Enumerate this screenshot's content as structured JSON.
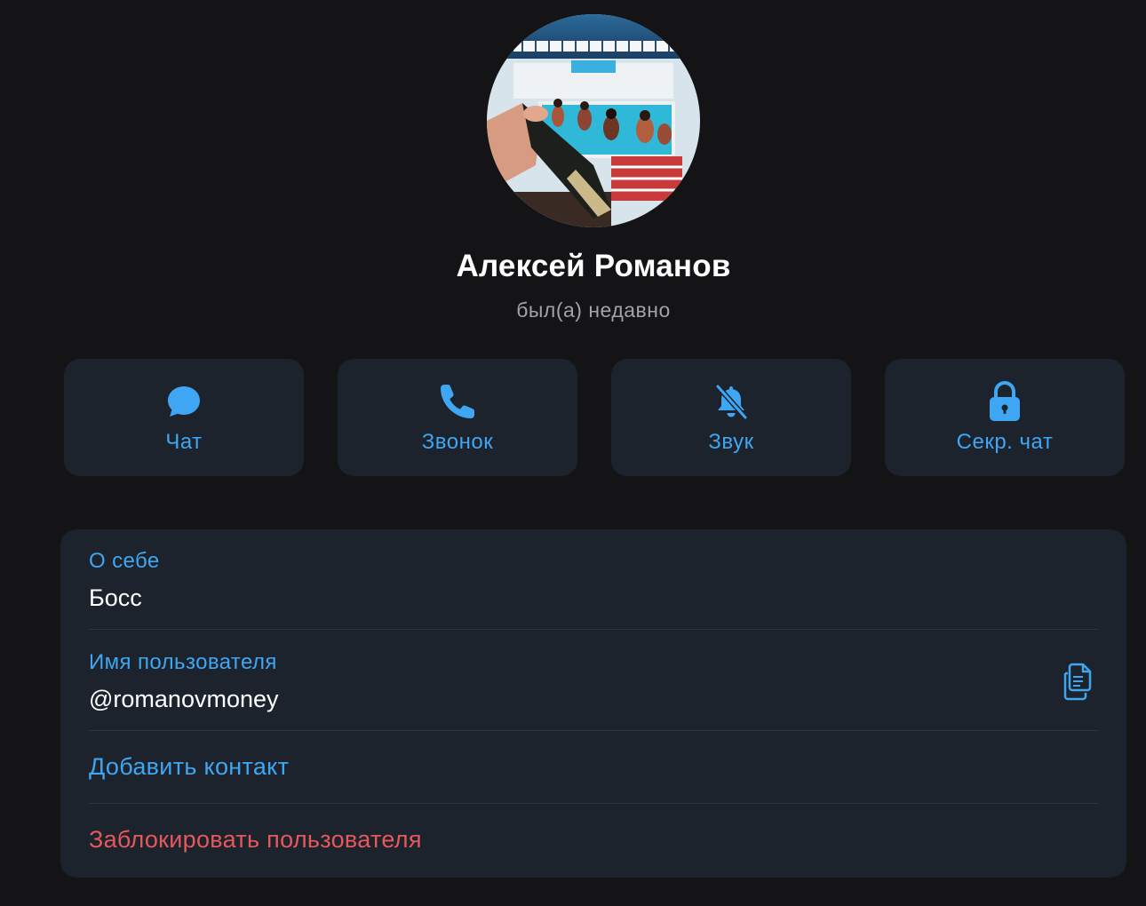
{
  "profile": {
    "name": "Алексей Романов",
    "status": "был(а) недавно",
    "avatar_alt": "profile photo"
  },
  "actions": [
    {
      "label": "Чат",
      "icon": "chat-bubble-icon"
    },
    {
      "label": "Звонок",
      "icon": "phone-icon"
    },
    {
      "label": "Звук",
      "icon": "bell-muted-icon"
    },
    {
      "label": "Секр. чат",
      "icon": "lock-icon"
    }
  ],
  "info": {
    "bio_label": "О себе",
    "bio_value": "Босс",
    "username_label": "Имя пользователя",
    "username_value": "@romanovmoney",
    "copy_icon": "copy-icon",
    "add_contact": "Добавить контакт",
    "block_user": "Заблокировать пользователя"
  },
  "colors": {
    "background": "#141416",
    "card": "#1c232c",
    "accent": "#3ea6f2",
    "danger": "#e5585c",
    "text": "#ffffff",
    "muted": "#9fa3aa"
  }
}
